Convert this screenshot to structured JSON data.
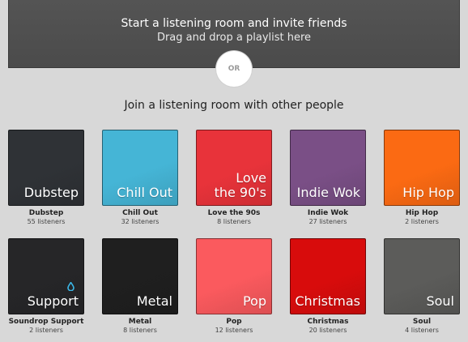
{
  "drop_zone": {
    "title": "Start a listening room and invite friends",
    "subtitle": "Drag and drop a playlist here"
  },
  "or_label": "OR",
  "section_title": "Join a listening room with other people",
  "rooms": [
    {
      "tile_label": "Dubstep",
      "name": "Dubstep",
      "listeners": "55 listeners",
      "color": "#2f3236"
    },
    {
      "tile_label": "Chill Out",
      "name": "Chill Out",
      "listeners": "32 listeners",
      "color": "#45b5d6"
    },
    {
      "tile_label": "Love\nthe 90's",
      "name": "Love the 90s",
      "listeners": "8 listeners",
      "color": "#e8333a"
    },
    {
      "tile_label": "Indie Wok",
      "name": "Indie Wok",
      "listeners": "27 listeners",
      "color": "#7a4f86"
    },
    {
      "tile_label": "Hip Hop",
      "name": "Hip Hop",
      "listeners": "2 listeners",
      "color": "#fb6a13"
    },
    {
      "tile_label": "Support",
      "name": "Soundrop Support",
      "listeners": "2 listeners",
      "color": "#262628",
      "icon": "drop-icon"
    },
    {
      "tile_label": "Metal",
      "name": "Metal",
      "listeners": "8 listeners",
      "color": "#1f1f1f"
    },
    {
      "tile_label": "Pop",
      "name": "Pop",
      "listeners": "12 listeners",
      "color": "#fb5a5e"
    },
    {
      "tile_label": "Christmas",
      "name": "Christmas",
      "listeners": "20 listeners",
      "color": "#d80c0c"
    },
    {
      "tile_label": "Soul",
      "name": "Soul",
      "listeners": "4 listeners",
      "color": "#5c5c5a"
    }
  ],
  "accent_colors": {
    "drop_icon": "#3bb8e8"
  }
}
